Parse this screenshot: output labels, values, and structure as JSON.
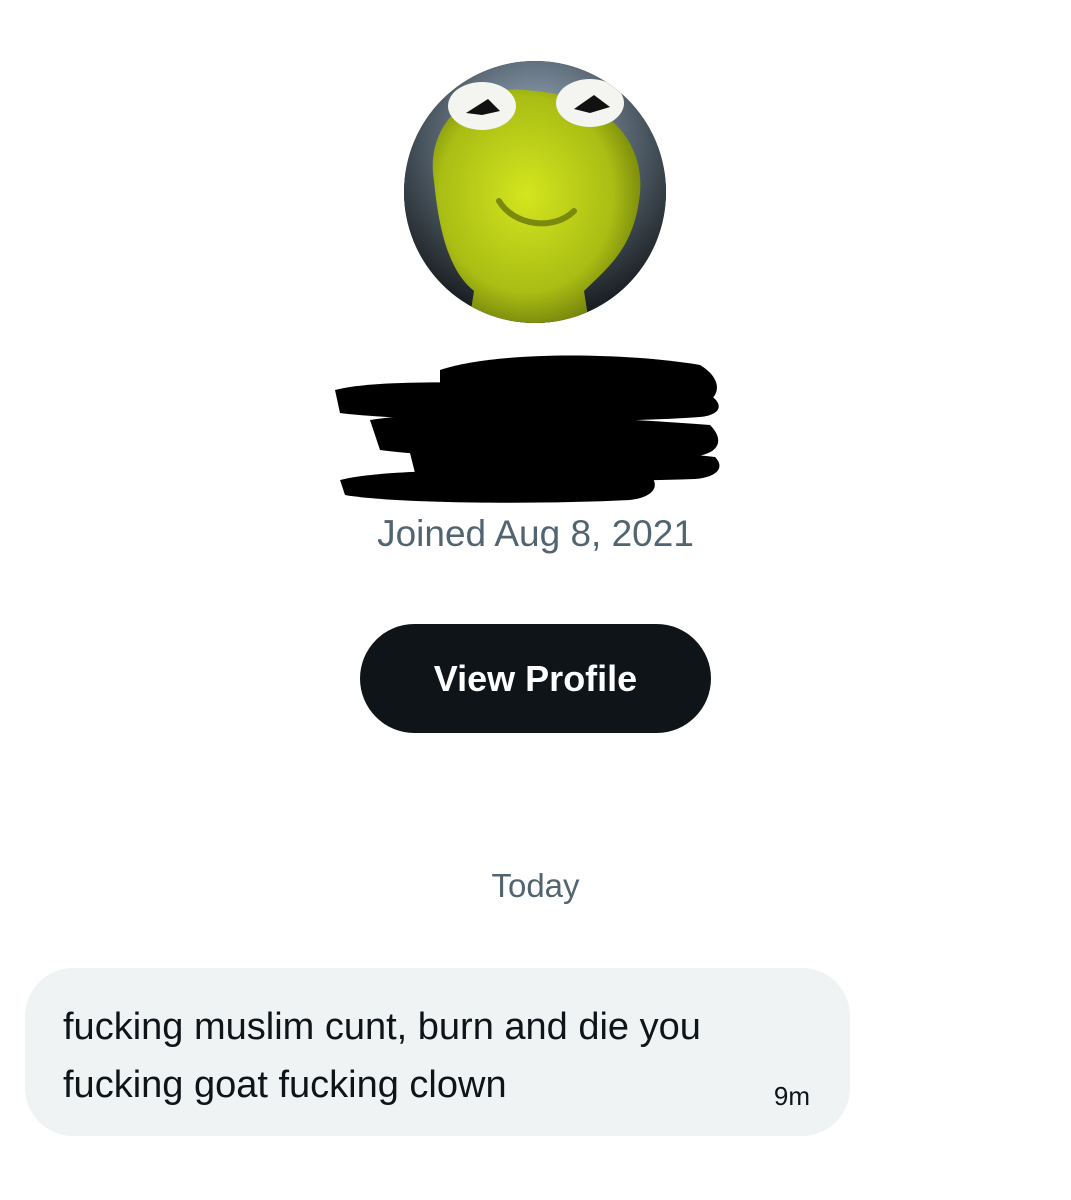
{
  "profile": {
    "joined": "Joined Aug 8, 2021",
    "view_profile_label": "View Profile",
    "avatar_icon": "frog-avatar-image"
  },
  "conversation": {
    "day_separator": "Today",
    "messages": [
      {
        "text": "fucking muslim cunt, burn and die you\nfucking goat fucking clown",
        "time": "9m"
      }
    ]
  },
  "colors": {
    "button_bg": "#0f1419",
    "secondary_text": "#536471",
    "bubble_bg": "#eff3f4"
  }
}
